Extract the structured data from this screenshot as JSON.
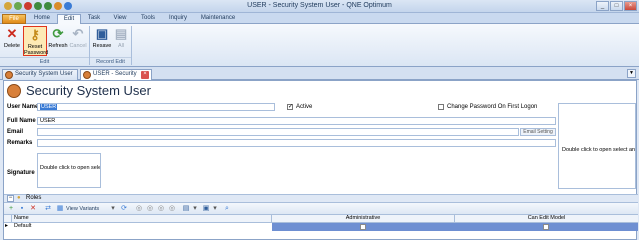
{
  "window": {
    "title": "USER - Security System User - QNE Optimum"
  },
  "ribbon": {
    "tabs": [
      "File",
      "Home",
      "Edit",
      "Task",
      "View",
      "Tools",
      "Inquiry",
      "Maintenance"
    ],
    "buttons": {
      "delete": "Delete",
      "reset_password": "Reset Password",
      "refresh": "Refresh",
      "cancel": "Cancel",
      "resave": "Resave",
      "all": "All"
    },
    "groups": {
      "edit": "Edit",
      "record_edit": "Record Edit"
    }
  },
  "doc_tabs": [
    "Security System User",
    "USER - Security System"
  ],
  "form": {
    "title": "Security System User",
    "user_name_label": "User Name",
    "user_name_value": "USER",
    "active_label": "Active",
    "change_password_label": "Change Password On First Logon",
    "full_name_label": "Full Name",
    "full_name_value": "USER",
    "email_label": "Email",
    "email_setting": "Email Setting",
    "remarks_label": "Remarks",
    "signature_label": "Signature",
    "signature_hint": "Double click to open sele...",
    "picture_hint": "Double click to open select an ima"
  },
  "roles": {
    "title": "Roles",
    "view_variants": "View Variants",
    "columns": [
      "Name",
      "Administrative",
      "Can Edit Model"
    ],
    "rows": [
      {
        "name": "Default"
      }
    ]
  },
  "colors": {
    "accent": "#3a7bd5",
    "ribbon_file": "#e08a18",
    "selected_row": "#6e8fd2"
  }
}
